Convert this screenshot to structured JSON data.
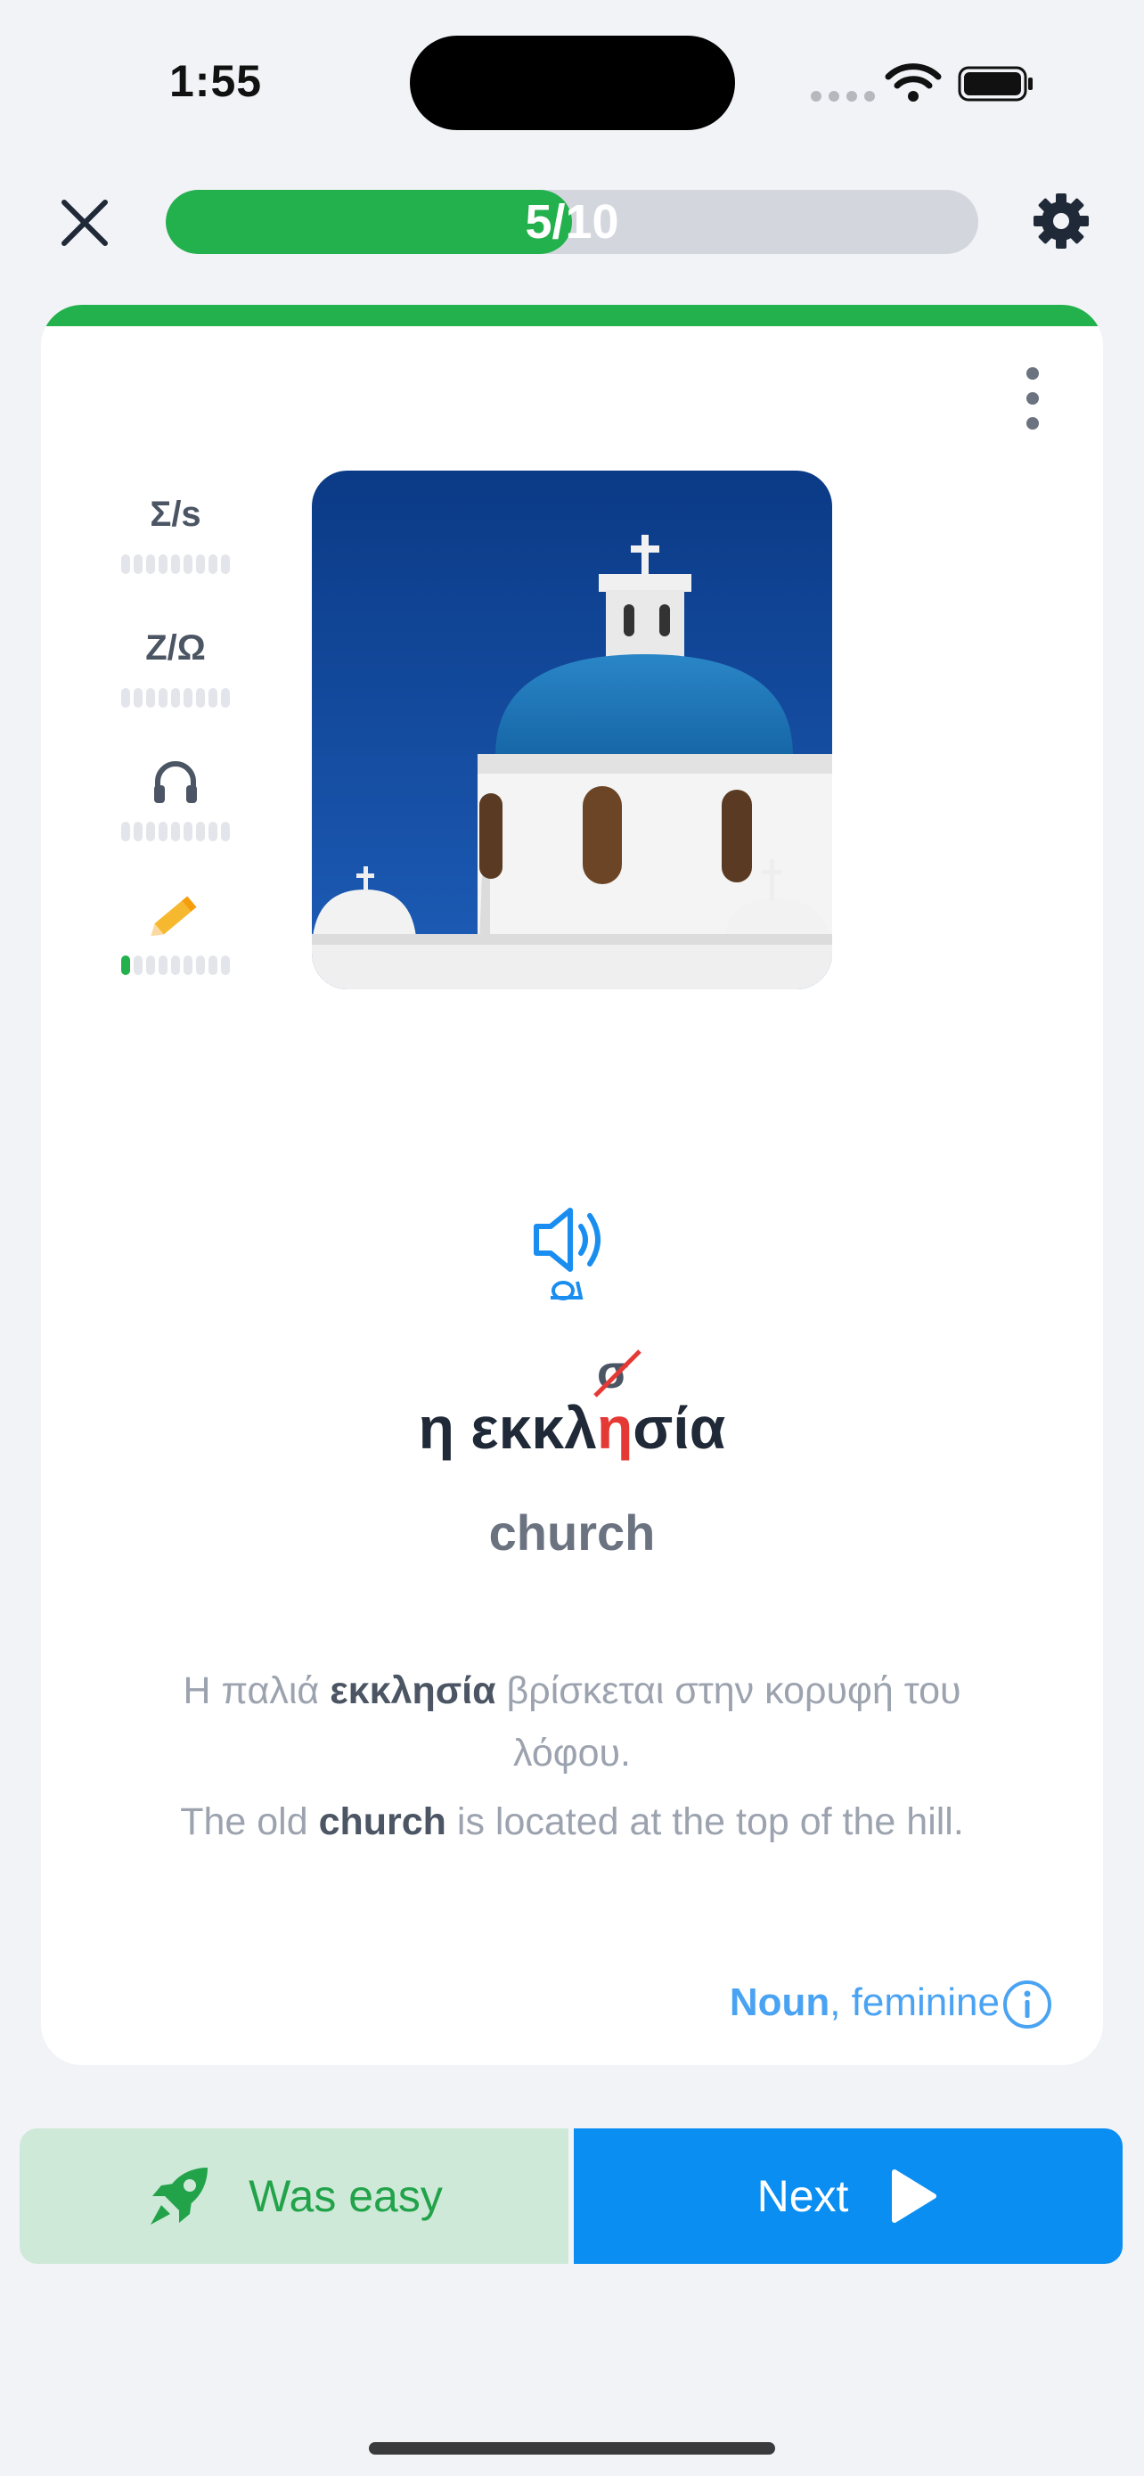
{
  "status_bar": {
    "time": "1:55"
  },
  "header": {
    "progress_text": "5/10",
    "progress_fraction": 0.5
  },
  "card": {
    "skills": [
      {
        "name": "greek-latin-reading",
        "icon_text": "Σ/s",
        "level": 0
      },
      {
        "name": "latin-greek-reading",
        "icon_text": "Z/Ω",
        "level": 0
      },
      {
        "name": "listening",
        "icon_text": "headphones",
        "level": 0
      },
      {
        "name": "writing",
        "icon_text": "pencil",
        "level": 1
      }
    ],
    "correction_letter": "σ",
    "word_prefix": "η εκκλ",
    "word_wrong_letter": "η",
    "word_suffix": "σία",
    "translation": "church",
    "example_gr_before": "Η παλιά ",
    "example_gr_bold": "εκκλησία",
    "example_gr_after": " βρίσκεται στην κορυφή του λόφου.",
    "example_en_before": "The old ",
    "example_en_bold": "church",
    "example_en_after": " is located at the top of the hill.",
    "pos_bold": "Noun",
    "pos_rest": ", feminine"
  },
  "buttons": {
    "easy_label": "Was easy",
    "next_label": "Next"
  },
  "colors": {
    "accent_green": "#22b14c",
    "accent_blue": "#0a8ef2",
    "error_red": "#e53935"
  }
}
